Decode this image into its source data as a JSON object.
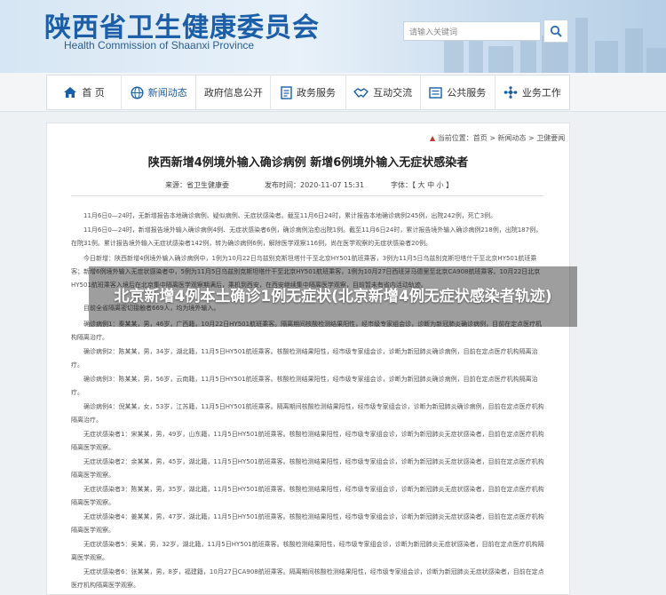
{
  "header": {
    "title_cn": "陕西省卫生健康委员会",
    "title_en": "Health Commission of Shaanxi Province",
    "search_placeholder": "请输入关键词"
  },
  "nav": [
    {
      "label": "首 页",
      "icon": "home-icon"
    },
    {
      "label": "新闻动态",
      "icon": "globe-icon"
    },
    {
      "label": "政府信息公开",
      "icon": ""
    },
    {
      "label": "政务服务",
      "icon": "document-icon"
    },
    {
      "label": "互动交流",
      "icon": "handshake-icon"
    },
    {
      "label": "公共服务",
      "icon": "list-icon"
    },
    {
      "label": "业务工作",
      "icon": "network-icon"
    }
  ],
  "breadcrumb": "当前位置：首页 > 新闻动态 > 卫健要闻",
  "article": {
    "title": "陕西新增4例境外输入确诊病例 新增6例境外输入无症状感染者",
    "source": "来源：省卫生健康委",
    "date": "发布时间：2020-11-07 15:31",
    "font_size": "字体：【 大 中 小 】",
    "paragraphs": [
      "11月6日0—24时，无新增报告本地确诊病例、疑似病例、无症状感染者。截至11月6日24时，累计报告本地确诊病例245例，出院242例，死亡3例。",
      "11月6日0—24时，新增报告境外输入确诊病例4例、无症状感染者6例，确诊病例治愈出院1例。截至11月6日24时，累计报告境外输入确诊病例218例，出院187例，在院31例。累计报告境外输入无症状感染者142例，转为确诊病例6例，解除医学观察116例，尚在医学观察的无症状感染者20例。",
      "今日新增：陕西新增4例境外输入确诊病例中，1例为10月22日乌兹别克斯坦塔什干至北京HY501航班乘客，3例为11月5日乌兹别克斯坦塔什干至北京HY501航班乘客；新增6例境外输入无症状感染者中，5例为11月5日乌兹别克斯坦塔什干至北京HY501航班乘客，1例为10月27日西班牙马德里至北京CA908航班乘客。10月22日北京HY501航班乘客入境后在北京集中隔离医学观察期满后，乘机到西安，在西安继续集中隔离医学观察，目前暂未有省内活动轨迹。",
      "目前全省隔离密切接触者669人，均为境外输入。",
      "确诊病例1：秦某某，男，46岁，广西籍，10月22日HY501航班乘客。隔离期间核酸检测结果阳性，经市级专家组会诊，诊断为新冠肺炎确诊病例，目前在定点医疗机构隔离治疗。",
      "确诊病例2：陈某某，男，34岁，湖北籍，11月5日HY501航班乘客。核酸检测结果阳性，经市级专家组会诊，诊断为新冠肺炎确诊病例，目前在定点医疗机构隔离治疗。",
      "确诊病例3：陈某某，男，56岁，云南籍，11月5日HY501航班乘客。核酸检测结果阳性，经市级专家组会诊，诊断为新冠肺炎确诊病例，目前在定点医疗机构隔离治疗。",
      "确诊病例4：倪某某，女，53岁，江苏籍，11月5日HY501航班乘客。隔离期间核酸检测结果阳性，经市级专家组会诊，诊断为新冠肺炎确诊病例，目前在定点医疗机构隔离治疗。",
      "无症状感染者1：宋某某，男，49岁，山东籍，11月5日HY501航班乘客。核酸检测结果阳性，经市级专家组会诊，诊断为新冠肺炎无症状感染者，目前在定点医疗机构隔离医学观察。",
      "无症状感染者2：余某某，男，45岁，湖北籍，11月5日HY501航班乘客。核酸检测结果阳性，经市级专家组会诊，诊断为新冠肺炎无症状感染者，目前在定点医疗机构隔离医学观察。",
      "无症状感染者3：陈某某，男，35岁，湖北籍，11月5日HY501航班乘客。核酸检测结果阳性，经市级专家组会诊，诊断为新冠肺炎无症状感染者，目前在定点医疗机构隔离医学观察。",
      "无症状感染者4：姜某某，男，47岁，湖北籍，11月5日HY501航班乘客。核酸检测结果阳性，经市级专家组会诊，诊断为新冠肺炎无症状感染者，目前在定点医疗机构隔离医学观察。",
      "无症状感染者5：吴某，男，32岁，湖北籍，11月5日HY501航班乘客。核酸检测结果阳性，经市级专家组会诊，诊断为新冠肺炎无症状感染者，目前在定点医疗机构隔离医学观察。",
      "无症状感染者6：张某某，男，8岁，福建籍，10月27日CA908航班乘客。隔离期间核酸检测结果阳性，经市级专家组会诊，诊断为新冠肺炎无症状感染者，目前在定点医疗机构隔离医学观察。"
    ]
  },
  "overlay_caption": "北京新增4例本土确诊1例无症状(北京新增4例无症状感染者轨迹)"
}
